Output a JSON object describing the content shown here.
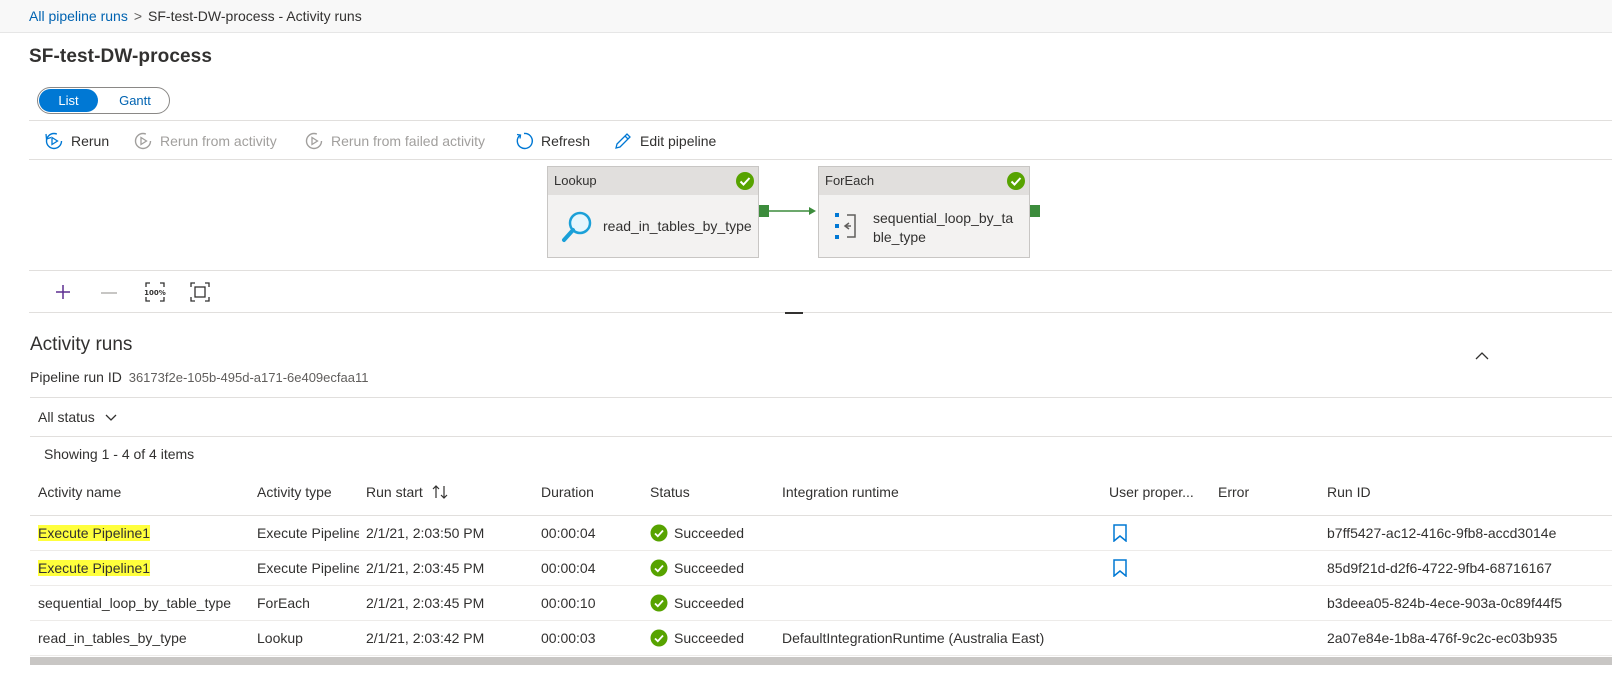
{
  "breadcrumb": {
    "root": "All pipeline runs",
    "separator": ">",
    "current": "SF-test-DW-process - Activity runs"
  },
  "page_title": "SF-test-DW-process",
  "view_toggle": {
    "list": "List",
    "gantt": "Gantt",
    "selected": "List"
  },
  "toolbar": {
    "rerun": "Rerun",
    "rerun_from_activity": "Rerun from activity",
    "rerun_from_failed": "Rerun from failed activity",
    "refresh": "Refresh",
    "edit_pipeline": "Edit pipeline"
  },
  "canvas": {
    "lookup_node": {
      "type": "Lookup",
      "name": "read_in_tables_by_type",
      "status": "succeeded"
    },
    "foreach_node": {
      "type": "ForEach",
      "name_line1": "sequential_loop_by_ta",
      "name_line2": "ble_type",
      "status": "succeeded"
    }
  },
  "zoom": {
    "zoom_in": "+",
    "zoom_out": "—",
    "reset": "100%",
    "fit": "fit"
  },
  "activity_runs": {
    "title": "Activity runs",
    "pipeline_run_id_label": "Pipeline run ID",
    "pipeline_run_id": "36173f2e-105b-495d-a171-6e409ecfaa11",
    "status_filter": "All status",
    "showing": "Showing 1 - 4 of 4 items",
    "columns": [
      "Activity name",
      "Activity type",
      "Run start",
      "Duration",
      "Status",
      "Integration runtime",
      "User proper...",
      "Error",
      "Run ID"
    ],
    "rows": [
      {
        "name": "Execute Pipeline1",
        "type": "Execute Pipeline",
        "run_start": "2/1/21, 2:03:50 PM",
        "duration": "00:00:04",
        "status": "Succeeded",
        "runtime": "",
        "user_props": true,
        "error": "",
        "run_id": "b7ff5427-ac12-416c-9fb8-accd3014e",
        "highlighted": true
      },
      {
        "name": "Execute Pipeline1",
        "type": "Execute Pipeline",
        "run_start": "2/1/21, 2:03:45 PM",
        "duration": "00:00:04",
        "status": "Succeeded",
        "runtime": "",
        "user_props": true,
        "error": "",
        "run_id": "85d9f21d-d2f6-4722-9fb4-68716167",
        "highlighted": true
      },
      {
        "name": "sequential_loop_by_table_type",
        "type": "ForEach",
        "run_start": "2/1/21, 2:03:45 PM",
        "duration": "00:00:10",
        "status": "Succeeded",
        "runtime": "",
        "user_props": false,
        "error": "",
        "run_id": "b3deea05-824b-4ece-903a-0c89f44f5",
        "highlighted": false
      },
      {
        "name": "read_in_tables_by_type",
        "type": "Lookup",
        "run_start": "2/1/21, 2:03:42 PM",
        "duration": "00:00:03",
        "status": "Succeeded",
        "runtime": "DefaultIntegrationRuntime (Australia East)",
        "user_props": false,
        "error": "",
        "run_id": "2a07e84e-1b8a-476f-9c2c-ec03b935",
        "highlighted": false
      }
    ]
  },
  "colors": {
    "accent": "#0078d4",
    "link": "#0063b1",
    "success": "#57a300",
    "highlight": "#ffff3c",
    "port": "#3c8c3c"
  }
}
